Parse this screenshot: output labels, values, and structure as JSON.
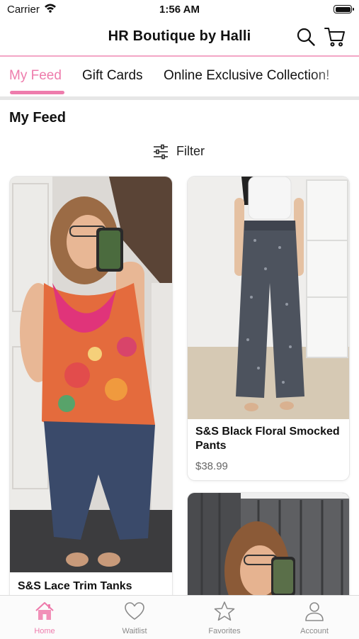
{
  "status_bar": {
    "carrier": "Carrier",
    "time": "1:56 AM"
  },
  "header": {
    "title": "HR Boutique by Halli",
    "search_icon": "search-icon",
    "cart_icon": "cart-icon"
  },
  "tabs": [
    {
      "label": "My Feed",
      "active": true
    },
    {
      "label": "Gift Cards",
      "active": false
    },
    {
      "label": "Online Exclusive Collection!",
      "active": false
    }
  ],
  "feed": {
    "heading": "My Feed",
    "filter_label": "Filter"
  },
  "products": [
    {
      "title": "S&S Lace Trim Tanks",
      "price": ""
    },
    {
      "title": "S&S Black Floral Smocked Pants",
      "price": "$38.99"
    },
    {
      "title": "",
      "price": ""
    }
  ],
  "tabbar": [
    {
      "label": "Home",
      "icon": "home-icon",
      "active": true
    },
    {
      "label": "Waitlist",
      "icon": "heart-icon",
      "active": false
    },
    {
      "label": "Favorites",
      "icon": "star-icon",
      "active": false
    },
    {
      "label": "Account",
      "icon": "person-icon",
      "active": false
    }
  ],
  "colors": {
    "accent": "#ee7cac",
    "header_line": "#f3a6c6",
    "inactive": "#8a8a8a"
  }
}
